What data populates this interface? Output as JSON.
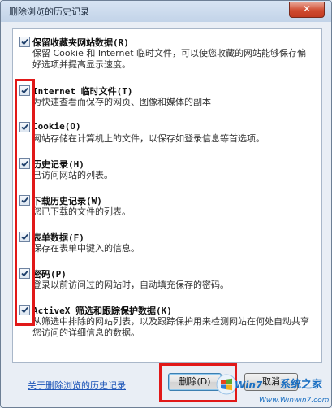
{
  "window": {
    "title": "删除浏览的历史记录",
    "close_label": "✕"
  },
  "options": [
    {
      "title": "保留收藏夹网站数据(R)",
      "desc": "保留 Cookie 和 Internet 临时文件，可以使您收藏的网站能够保存偏好选项并提高显示速度。",
      "checked": true
    },
    {
      "title": "Internet 临时文件(T)",
      "desc": "为快速查看而保存的网页、图像和媒体的副本",
      "checked": true
    },
    {
      "title": "Cookie(O)",
      "desc": "网站存储在计算机上的文件，以保存如登录信息等首选项。",
      "checked": true
    },
    {
      "title": "历史记录(H)",
      "desc": "已访问网站的列表。",
      "checked": true
    },
    {
      "title": "下载历史记录(W)",
      "desc": "您已下载的文件的列表。",
      "checked": true
    },
    {
      "title": "表单数据(F)",
      "desc": "保存在表单中键入的信息。",
      "checked": true
    },
    {
      "title": "密码(P)",
      "desc": "登录以前访问过的网站时，自动填充保存的密码。",
      "checked": true
    },
    {
      "title": "ActiveX 筛选和跟踪保护数据(K)",
      "desc": "从筛选中排除的网站列表，以及跟踪保护用来检测网站在何处自动共享您访问的详细信息的数据。",
      "checked": true
    }
  ],
  "footer": {
    "link": "关于删除浏览的历史记录",
    "delete_label": "删除(D)",
    "cancel_label": "取消"
  },
  "watermark": {
    "logo": "Win7",
    "site": "系统之家",
    "url": "Www.Winwin7.com"
  },
  "colors": {
    "highlight": "#e11818",
    "link": "#1d55b8"
  }
}
